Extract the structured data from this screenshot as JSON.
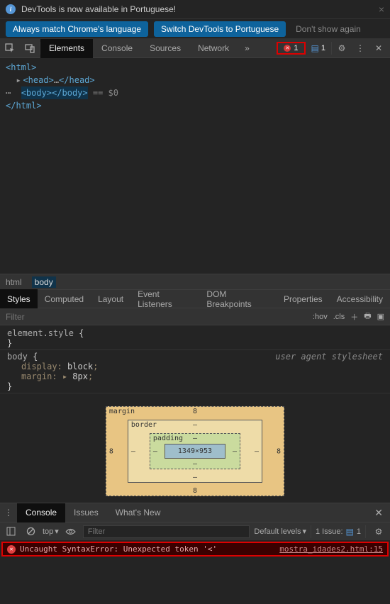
{
  "notification": {
    "text": "DevTools is now available in Portuguese!",
    "buttons": [
      "Always match Chrome's language",
      "Switch DevTools to Portuguese",
      "Don't show again"
    ]
  },
  "main_tabs": [
    "Elements",
    "Console",
    "Sources",
    "Network"
  ],
  "error_count": "1",
  "issue_count": "1",
  "dom": {
    "l1": "<html>",
    "l2_tri": "▸",
    "l2a": "<head>",
    "l2b": "…",
    "l2c": "</head>",
    "l3a": "<body>",
    "l3b": "</body>",
    "l3c": " == $0",
    "l4": "</html>"
  },
  "breadcrumb": [
    "html",
    "body"
  ],
  "style_tabs": [
    "Styles",
    "Computed",
    "Layout",
    "Event Listeners",
    "DOM Breakpoints",
    "Properties",
    "Accessibility"
  ],
  "filter_placeholder": "Filter",
  "filter_tools": {
    "hov": ":hov",
    "cls": ".cls"
  },
  "styles": {
    "rule1_sel": "element.style",
    "rule2_sel": "body",
    "rule2_ua": "user agent stylesheet",
    "props": [
      {
        "name": "display",
        "value": "block"
      },
      {
        "name": "margin",
        "value": "8px",
        "arrow": "▸"
      }
    ]
  },
  "box_model": {
    "margin_label": "margin",
    "border_label": "border",
    "padding_label": "padding",
    "content": "1349×953",
    "margin_v": "8",
    "border_v": "–",
    "padding_v": "–"
  },
  "drawer_tabs": [
    "Console",
    "Issues",
    "What's New"
  ],
  "console": {
    "context": "top",
    "filter_placeholder": "Filter",
    "levels": "Default levels",
    "issues_label": "1 Issue:",
    "issues_count": "1",
    "error_msg": "Uncaught SyntaxError: Unexpected token '<'",
    "error_src": "mostra_idades2.html:15"
  }
}
